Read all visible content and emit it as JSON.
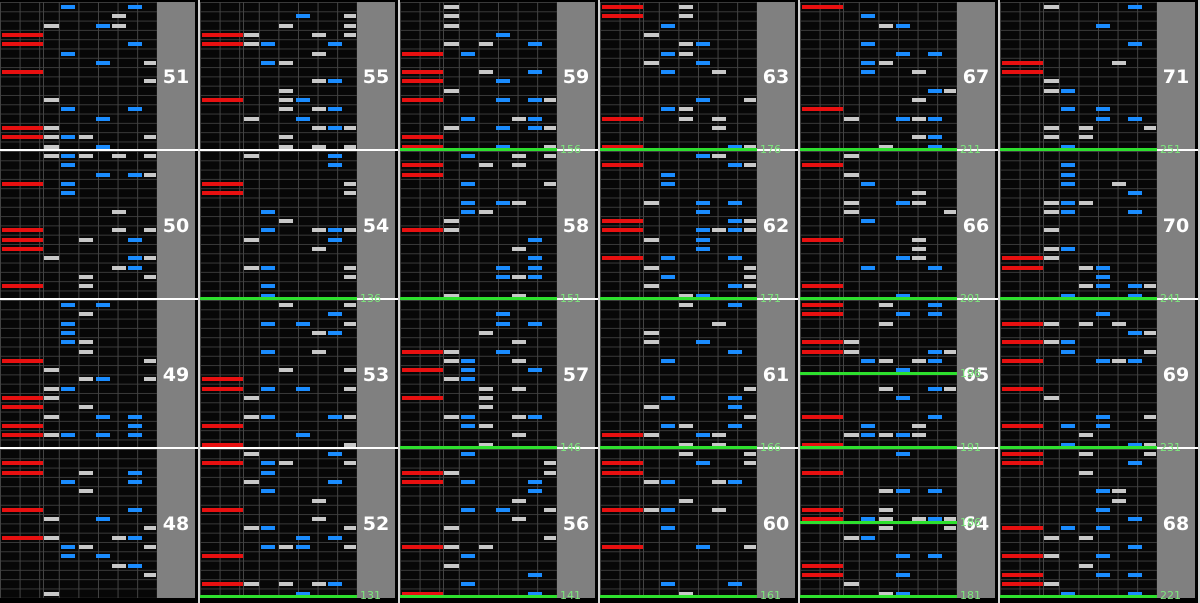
{
  "colors": {
    "scratch": "#e81010",
    "key_blue": "#1a8cff",
    "key_white": "#c8c8c8",
    "gutter": "#808080",
    "marker": "#2ee02e",
    "marker_label": "#7de87d"
  },
  "columns": [
    {
      "measures": [
        "51",
        "50",
        "49",
        "48"
      ],
      "markers": []
    },
    {
      "measures": [
        "55",
        "54",
        "53",
        "52"
      ],
      "markers": [
        {
          "label": "136",
          "pos": "m1-bottom"
        },
        {
          "label": "131",
          "pos": "m3-bottom"
        }
      ]
    },
    {
      "measures": [
        "59",
        "58",
        "57",
        "56"
      ],
      "markers": [
        {
          "label": "156",
          "pos": "m0-bottom"
        },
        {
          "label": "151",
          "pos": "m1-bottom"
        },
        {
          "label": "146",
          "pos": "m2-bottom"
        },
        {
          "label": "141",
          "pos": "m3-bottom"
        }
      ]
    },
    {
      "measures": [
        "63",
        "62",
        "61",
        "60"
      ],
      "markers": [
        {
          "label": "176",
          "pos": "m0-bottom"
        },
        {
          "label": "171",
          "pos": "m1-bottom"
        },
        {
          "label": "166",
          "pos": "m2-bottom"
        },
        {
          "label": "161",
          "pos": "m3-bottom"
        }
      ]
    },
    {
      "measures": [
        "67",
        "66",
        "65",
        "64"
      ],
      "markers": [
        {
          "label": "211",
          "pos": "m0-bottom"
        },
        {
          "label": "201",
          "pos": "m1-bottom"
        },
        {
          "label": "196",
          "pos": "m2-mid"
        },
        {
          "label": "191",
          "pos": "m2-bottom"
        },
        {
          "label": "186",
          "pos": "m3-mid"
        },
        {
          "label": "181",
          "pos": "m3-bottom"
        }
      ]
    },
    {
      "measures": [
        "71",
        "70",
        "69",
        "68"
      ],
      "markers": [
        {
          "label": "251",
          "pos": "m0-bottom"
        },
        {
          "label": "241",
          "pos": "m1-bottom"
        },
        {
          "label": "231",
          "pos": "m2-bottom"
        },
        {
          "label": "221",
          "pos": "m3-bottom"
        }
      ]
    }
  ]
}
